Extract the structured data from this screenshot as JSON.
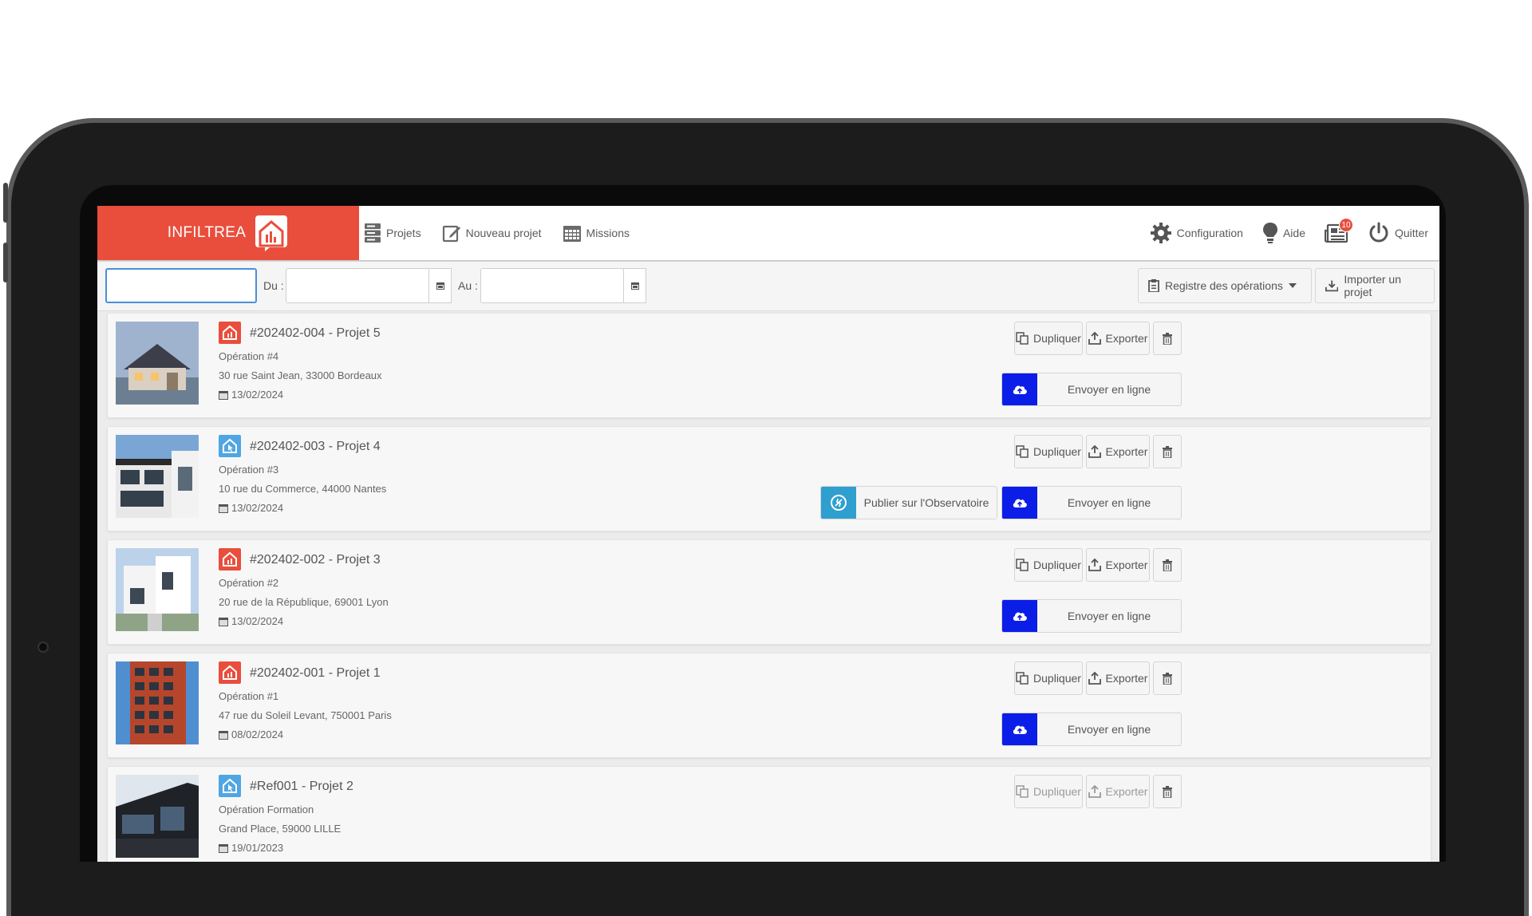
{
  "brand": {
    "name": "INFILTREA"
  },
  "nav": {
    "projets": "Projets",
    "nouveau": "Nouveau projet",
    "missions": "Missions"
  },
  "right_nav": {
    "config": "Configuration",
    "aide": "Aide",
    "notifications_count": "10",
    "quitter": "Quitter"
  },
  "filters": {
    "search_value": "",
    "du_label": "Du :",
    "au_label": "Au :",
    "du_value": "",
    "au_value": ""
  },
  "toolbar": {
    "registre": "Registre des opérations",
    "importer": "Importer un projet"
  },
  "actions": {
    "dupliquer": "Dupliquer",
    "exporter": "Exporter",
    "envoyer": "Envoyer en ligne",
    "publier": "Publier sur l'Observatoire"
  },
  "colors": {
    "brand_red": "#e94e3d",
    "send_blue": "#0b1ee8",
    "obs_teal": "#2f9fd0",
    "type_blue": "#4fa6e3"
  },
  "projects": [
    {
      "title": "#202402-004 - Projet 5",
      "operation": "Opération #4",
      "address": "30 rue Saint Jean, 33000 Bordeaux",
      "date": "13/02/2024",
      "type": "red"
    },
    {
      "title": "#202402-003 - Projet 4",
      "operation": "Opération #3",
      "address": "10 rue du Commerce, 44000 Nantes",
      "date": "13/02/2024",
      "type": "blue"
    },
    {
      "title": "#202402-002 - Projet 3",
      "operation": "Opération #2",
      "address": "20 rue de la République, 69001 Lyon",
      "date": "13/02/2024",
      "type": "red"
    },
    {
      "title": "#202402-001 - Projet 1",
      "operation": "Opération #1",
      "address": "47 rue du Soleil Levant, 750001 Paris",
      "date": "08/02/2024",
      "type": "red"
    },
    {
      "title": "#Ref001 - Projet  2",
      "operation": "Opération Formation",
      "address": "Grand Place, 59000 LILLE",
      "date": "19/01/2023",
      "type": "blue"
    }
  ]
}
